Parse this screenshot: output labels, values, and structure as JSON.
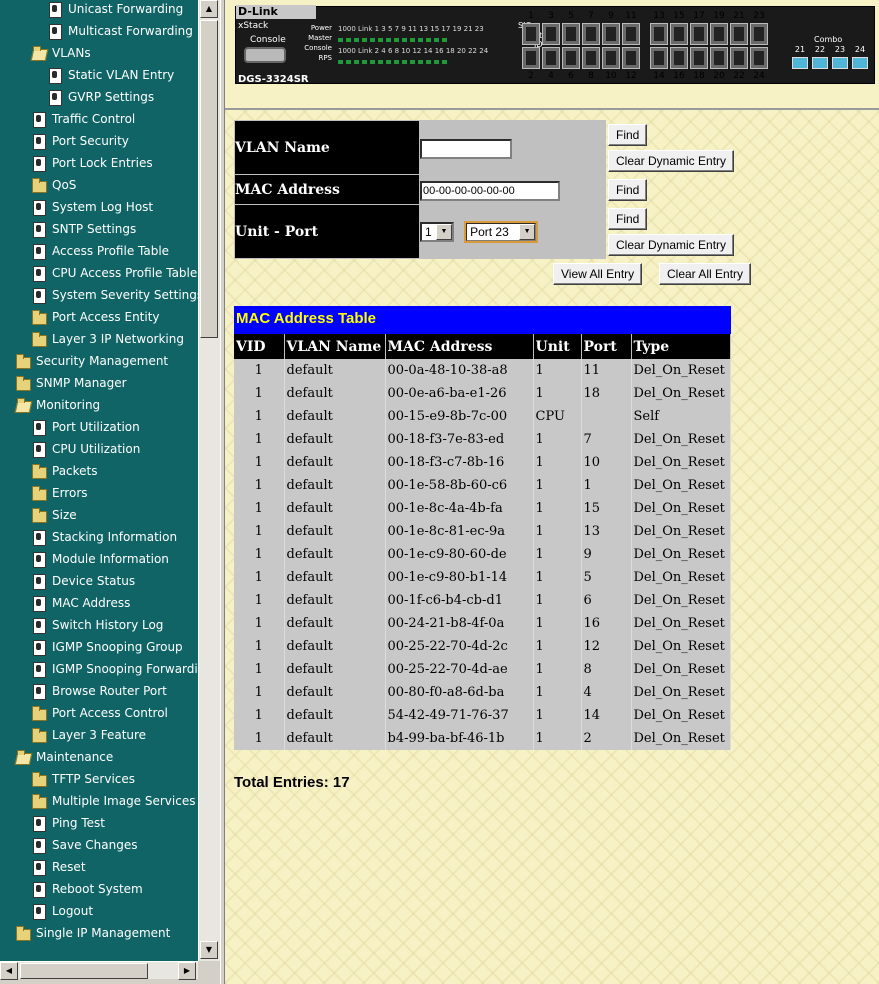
{
  "tree": [
    {
      "label": "Unicast Forwarding",
      "icon": "doc-icon",
      "level": 2
    },
    {
      "label": "Multicast Forwarding",
      "icon": "doc-icon",
      "level": 2
    },
    {
      "label": "VLANs",
      "icon": "open-folder-icon",
      "level": 1
    },
    {
      "label": "Static VLAN Entry",
      "icon": "doc-icon",
      "level": 2
    },
    {
      "label": "GVRP Settings",
      "icon": "doc-icon",
      "level": 2
    },
    {
      "label": "Traffic Control",
      "icon": "doc-icon",
      "level": 1
    },
    {
      "label": "Port Security",
      "icon": "doc-icon",
      "level": 1
    },
    {
      "label": "Port Lock Entries",
      "icon": "doc-icon",
      "level": 1
    },
    {
      "label": "QoS",
      "icon": "folder-icon",
      "level": 1
    },
    {
      "label": "System Log Host",
      "icon": "doc-icon",
      "level": 1
    },
    {
      "label": "SNTP Settings",
      "icon": "doc-icon",
      "level": 1
    },
    {
      "label": "Access Profile Table",
      "icon": "doc-icon",
      "level": 1
    },
    {
      "label": "CPU Access Profile Table",
      "icon": "doc-icon",
      "level": 1
    },
    {
      "label": "System Severity Settings",
      "icon": "doc-icon",
      "level": 1
    },
    {
      "label": "Port Access Entity",
      "icon": "folder-icon",
      "level": 1
    },
    {
      "label": "Layer 3 IP Networking",
      "icon": "folder-icon",
      "level": 1
    },
    {
      "label": "Security Management",
      "icon": "folder-icon",
      "level": 0
    },
    {
      "label": "SNMP Manager",
      "icon": "folder-icon",
      "level": 0
    },
    {
      "label": "Monitoring",
      "icon": "open-folder-icon",
      "level": 0
    },
    {
      "label": "Port Utilization",
      "icon": "doc-icon",
      "level": 1
    },
    {
      "label": "CPU Utilization",
      "icon": "doc-icon",
      "level": 1
    },
    {
      "label": "Packets",
      "icon": "folder-icon",
      "level": 1
    },
    {
      "label": "Errors",
      "icon": "folder-icon",
      "level": 1
    },
    {
      "label": "Size",
      "icon": "folder-icon",
      "level": 1
    },
    {
      "label": "Stacking Information",
      "icon": "doc-icon",
      "level": 1
    },
    {
      "label": "Module Information",
      "icon": "doc-icon",
      "level": 1
    },
    {
      "label": "Device Status",
      "icon": "doc-icon",
      "level": 1
    },
    {
      "label": "MAC Address",
      "icon": "doc-icon",
      "level": 1
    },
    {
      "label": "Switch History Log",
      "icon": "doc-icon",
      "level": 1
    },
    {
      "label": "IGMP Snooping Group",
      "icon": "doc-icon",
      "level": 1
    },
    {
      "label": "IGMP Snooping Forwarding",
      "icon": "doc-icon",
      "level": 1
    },
    {
      "label": "Browse Router Port",
      "icon": "doc-icon",
      "level": 1
    },
    {
      "label": "Port Access Control",
      "icon": "folder-icon",
      "level": 1
    },
    {
      "label": "Layer 3 Feature",
      "icon": "folder-icon",
      "level": 1
    },
    {
      "label": "Maintenance",
      "icon": "open-folder-icon",
      "level": 0
    },
    {
      "label": "TFTP Services",
      "icon": "folder-icon",
      "level": 1
    },
    {
      "label": "Multiple Image Services",
      "icon": "folder-icon",
      "level": 1
    },
    {
      "label": "Ping Test",
      "icon": "doc-icon",
      "level": 1
    },
    {
      "label": "Save Changes",
      "icon": "doc-icon",
      "level": 1
    },
    {
      "label": "Reset",
      "icon": "doc-icon",
      "level": 1
    },
    {
      "label": "Reboot System",
      "icon": "doc-icon",
      "level": 1
    },
    {
      "label": "Logout",
      "icon": "doc-icon",
      "level": 1
    },
    {
      "label": "Single IP Management",
      "icon": "folder-icon",
      "level": 0
    }
  ],
  "device": {
    "brand": "D-Link",
    "xstack": "xStack",
    "console": "Console",
    "model": "DGS-3324SR",
    "led_labels": [
      "Power",
      "Master",
      "Console",
      "RPS"
    ],
    "led_row1": "1000 Link 1 3 5 7 9 11 13 15 17 19 21 23",
    "led_row2": "1000 Link 2 4 6 8 10 12 14 16 18 20 22 24",
    "sio": "SIO",
    "stack_id": "Stack ID",
    "top_ports": [
      "1",
      "3",
      "5",
      "7",
      "9",
      "11",
      "13",
      "15",
      "17",
      "19",
      "21",
      "23"
    ],
    "bottom_ports": [
      "2",
      "4",
      "6",
      "8",
      "10",
      "12",
      "14",
      "16",
      "18",
      "20",
      "22",
      "24"
    ],
    "combo_label": "Combo",
    "combo_ports": [
      "21",
      "22",
      "23",
      "24"
    ]
  },
  "form": {
    "vlan_name_label": "VLAN Name",
    "vlan_name_value": "",
    "mac_label": "MAC Address",
    "mac_value": "00-00-00-00-00-00",
    "unit_port_label": "Unit - Port",
    "unit_value": "1",
    "port_value": "Port 23",
    "find": "Find",
    "clear_dynamic": "Clear Dynamic Entry",
    "view_all": "View All Entry",
    "clear_all": "Clear All Entry"
  },
  "mac_table": {
    "title": "MAC Address Table",
    "headers": [
      "VID",
      "VLAN Name",
      "MAC Address",
      "Unit",
      "Port",
      "Type"
    ],
    "rows": [
      [
        "1",
        "default",
        "00-0a-48-10-38-a8",
        "1",
        "11",
        "Del_On_Reset"
      ],
      [
        "1",
        "default",
        "00-0e-a6-ba-e1-26",
        "1",
        "18",
        "Del_On_Reset"
      ],
      [
        "1",
        "default",
        "00-15-e9-8b-7c-00",
        "CPU",
        "",
        "Self"
      ],
      [
        "1",
        "default",
        "00-18-f3-7e-83-ed",
        "1",
        "7",
        "Del_On_Reset"
      ],
      [
        "1",
        "default",
        "00-18-f3-c7-8b-16",
        "1",
        "10",
        "Del_On_Reset"
      ],
      [
        "1",
        "default",
        "00-1e-58-8b-60-c6",
        "1",
        "1",
        "Del_On_Reset"
      ],
      [
        "1",
        "default",
        "00-1e-8c-4a-4b-fa",
        "1",
        "15",
        "Del_On_Reset"
      ],
      [
        "1",
        "default",
        "00-1e-8c-81-ec-9a",
        "1",
        "13",
        "Del_On_Reset"
      ],
      [
        "1",
        "default",
        "00-1e-c9-80-60-de",
        "1",
        "9",
        "Del_On_Reset"
      ],
      [
        "1",
        "default",
        "00-1e-c9-80-b1-14",
        "1",
        "5",
        "Del_On_Reset"
      ],
      [
        "1",
        "default",
        "00-1f-c6-b4-cb-d1",
        "1",
        "6",
        "Del_On_Reset"
      ],
      [
        "1",
        "default",
        "00-24-21-b8-4f-0a",
        "1",
        "16",
        "Del_On_Reset"
      ],
      [
        "1",
        "default",
        "00-25-22-70-4d-2c",
        "1",
        "12",
        "Del_On_Reset"
      ],
      [
        "1",
        "default",
        "00-25-22-70-4d-ae",
        "1",
        "8",
        "Del_On_Reset"
      ],
      [
        "1",
        "default",
        "00-80-f0-a8-6d-ba",
        "1",
        "4",
        "Del_On_Reset"
      ],
      [
        "1",
        "default",
        "54-42-49-71-76-37",
        "1",
        "14",
        "Del_On_Reset"
      ],
      [
        "1",
        "default",
        "b4-99-ba-bf-46-1b",
        "1",
        "2",
        "Del_On_Reset"
      ]
    ],
    "total": "Total Entries: 17"
  },
  "colors": {
    "tree_bg": "#106466",
    "title_bar": "#0000ff",
    "title_text": "#ffff00"
  }
}
